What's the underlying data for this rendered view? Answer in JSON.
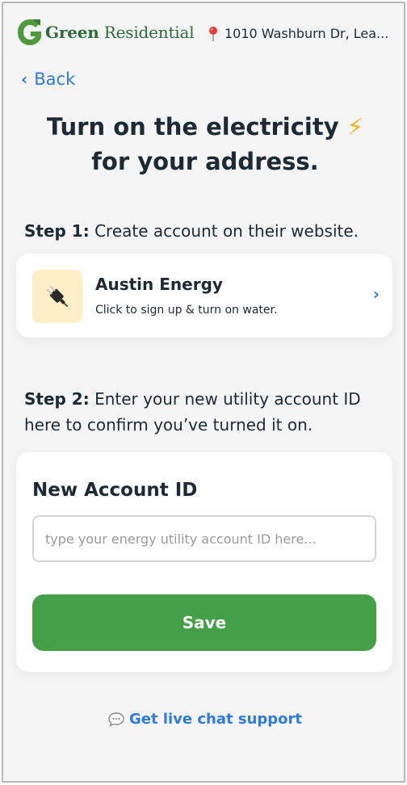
{
  "header": {
    "brand_bold": "Green",
    "brand_rest": " Residential",
    "address": "1010 Washburn Dr, Lea..."
  },
  "nav": {
    "back_label": "Back"
  },
  "headline": {
    "line1": "Turn on the electricity",
    "bolt": "⚡",
    "line2": "for your address."
  },
  "step1": {
    "prefix": "Step 1:",
    "text": " Create account on their website."
  },
  "provider": {
    "name": "Austin Energy",
    "subtitle": "Click to sign up & turn on water.",
    "icon": "plug-icon"
  },
  "step2": {
    "prefix": "Step 2:",
    "text": " Enter your new utility account ID here to confirm you’ve turned it on."
  },
  "account": {
    "title": "New Account ID",
    "placeholder": "type your energy utility account ID here...",
    "value": "",
    "save_label": "Save"
  },
  "support": {
    "chat_label": "Get live chat support"
  },
  "colors": {
    "brand_green": "#2f6b3a",
    "button_green": "#44a047",
    "link_blue": "#2d7be5",
    "bolt_yellow": "#f6b21a"
  }
}
